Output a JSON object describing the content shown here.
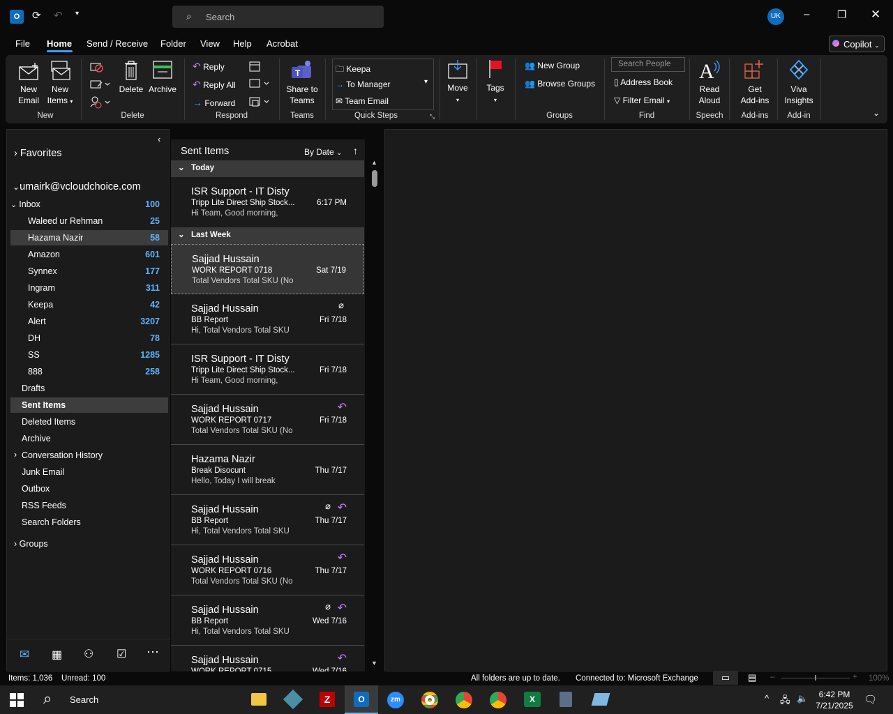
{
  "titlebar": {
    "search_placeholder": "Search",
    "avatar": "UK"
  },
  "menu": {
    "tabs": [
      "File",
      "Home",
      "Send / Receive",
      "Folder",
      "View",
      "Help",
      "Acrobat"
    ],
    "copilot": "Copilot"
  },
  "ribbon": {
    "new_email": "New\nEmail",
    "new_items": "New\nItems",
    "delete": "Delete",
    "archive": "Archive",
    "reply": "Reply",
    "reply_all": "Reply All",
    "forward": "Forward",
    "share_teams": "Share to\nTeams",
    "qs_keepa": "Keepa",
    "qs_manager": "To Manager",
    "qs_team": "Team Email",
    "move": "Move",
    "tags": "Tags",
    "new_group": "New Group",
    "browse_groups": "Browse Groups",
    "search_people": "Search People",
    "address_book": "Address Book",
    "filter_email": "Filter Email",
    "read_aloud": "Read\nAloud",
    "get_addins": "Get\nAdd-ins",
    "viva": "Viva\nInsights",
    "groups": {
      "new": "New",
      "delete": "Delete",
      "respond": "Respond",
      "teams": "Teams",
      "quick_steps": "Quick Steps",
      "groups": "Groups",
      "find": "Find",
      "speech": "Speech",
      "addins": "Add-ins",
      "addin": "Add-in"
    }
  },
  "nav": {
    "favorites": "Favorites",
    "account": "umairk@vcloudchoice.com",
    "inbox": {
      "label": "Inbox",
      "count": "100"
    },
    "subfolders": [
      {
        "label": "Waleed ur Rehman",
        "count": "25"
      },
      {
        "label": "Hazama Nazir",
        "count": "58"
      },
      {
        "label": "Amazon",
        "count": "601"
      },
      {
        "label": "Synnex",
        "count": "177"
      },
      {
        "label": "Ingram",
        "count": "311"
      },
      {
        "label": "Keepa",
        "count": "42"
      },
      {
        "label": "Alert",
        "count": "3207"
      },
      {
        "label": "DH",
        "count": "78"
      },
      {
        "label": "SS",
        "count": "1285"
      },
      {
        "label": "888",
        "count": "258"
      }
    ],
    "folders": [
      "Drafts",
      "Sent Items",
      "Deleted Items",
      "Archive",
      "Conversation History",
      "Junk Email",
      "Outbox",
      "RSS Feeds",
      "Search Folders"
    ],
    "groups": "Groups"
  },
  "list": {
    "title": "Sent Items",
    "sort": "By Date",
    "group_today": "Today",
    "group_lastweek": "Last Week",
    "messages": [
      {
        "from": "ISR Support - IT Disty",
        "subject": "Tripp Lite Direct Ship Stock...",
        "preview": "Hi Team,  Good morning,",
        "date": "6:17 PM"
      },
      {
        "from": "Sajjad Hussain",
        "subject": "WORK REPORT 0718",
        "preview": "Total Vendors  Total SKU (No",
        "date": "Sat 7/19"
      },
      {
        "from": "Sajjad Hussain",
        "subject": "BB Report",
        "preview": "Hi,  Total Vendors  Total SKU",
        "date": "Fri 7/18"
      },
      {
        "from": "ISR Support - IT Disty",
        "subject": "Tripp Lite Direct Ship Stock...",
        "preview": "Hi Team,  Good morning,",
        "date": "Fri 7/18"
      },
      {
        "from": "Sajjad Hussain",
        "subject": "WORK REPORT 0717",
        "preview": "Total Vendors  Total SKU (No",
        "date": "Fri 7/18"
      },
      {
        "from": "Hazama Nazir",
        "subject": "Break Disocunt",
        "preview": "Hello,  Today I will break",
        "date": "Thu 7/17"
      },
      {
        "from": "Sajjad Hussain",
        "subject": "BB Report",
        "preview": "Hi,  Total Vendors  Total SKU",
        "date": "Thu 7/17"
      },
      {
        "from": "Sajjad Hussain",
        "subject": "WORK REPORT 0716",
        "preview": "Total Vendors  Total SKU (No",
        "date": "Thu 7/17"
      },
      {
        "from": "Sajjad Hussain",
        "subject": "BB Report",
        "preview": "Hi,  Total Vendors  Total SKU",
        "date": "Wed 7/16"
      },
      {
        "from": "Sajjad Hussain",
        "subject": "WORK REPORT 0715",
        "preview": "",
        "date": "Wed 7/16"
      }
    ]
  },
  "status": {
    "items": "Items: 1,036",
    "unread": "Unread: 100",
    "sync": "All folders are up to date.",
    "connected": "Connected to: Microsoft Exchange",
    "zoom": "100%"
  },
  "taskbar": {
    "search": "Search",
    "time": "6:42 PM",
    "date": "7/21/2025"
  },
  "colors": {
    "accent": "#3b9cff",
    "count": "#5eb4ff",
    "reply_icon": "#c77dff"
  }
}
